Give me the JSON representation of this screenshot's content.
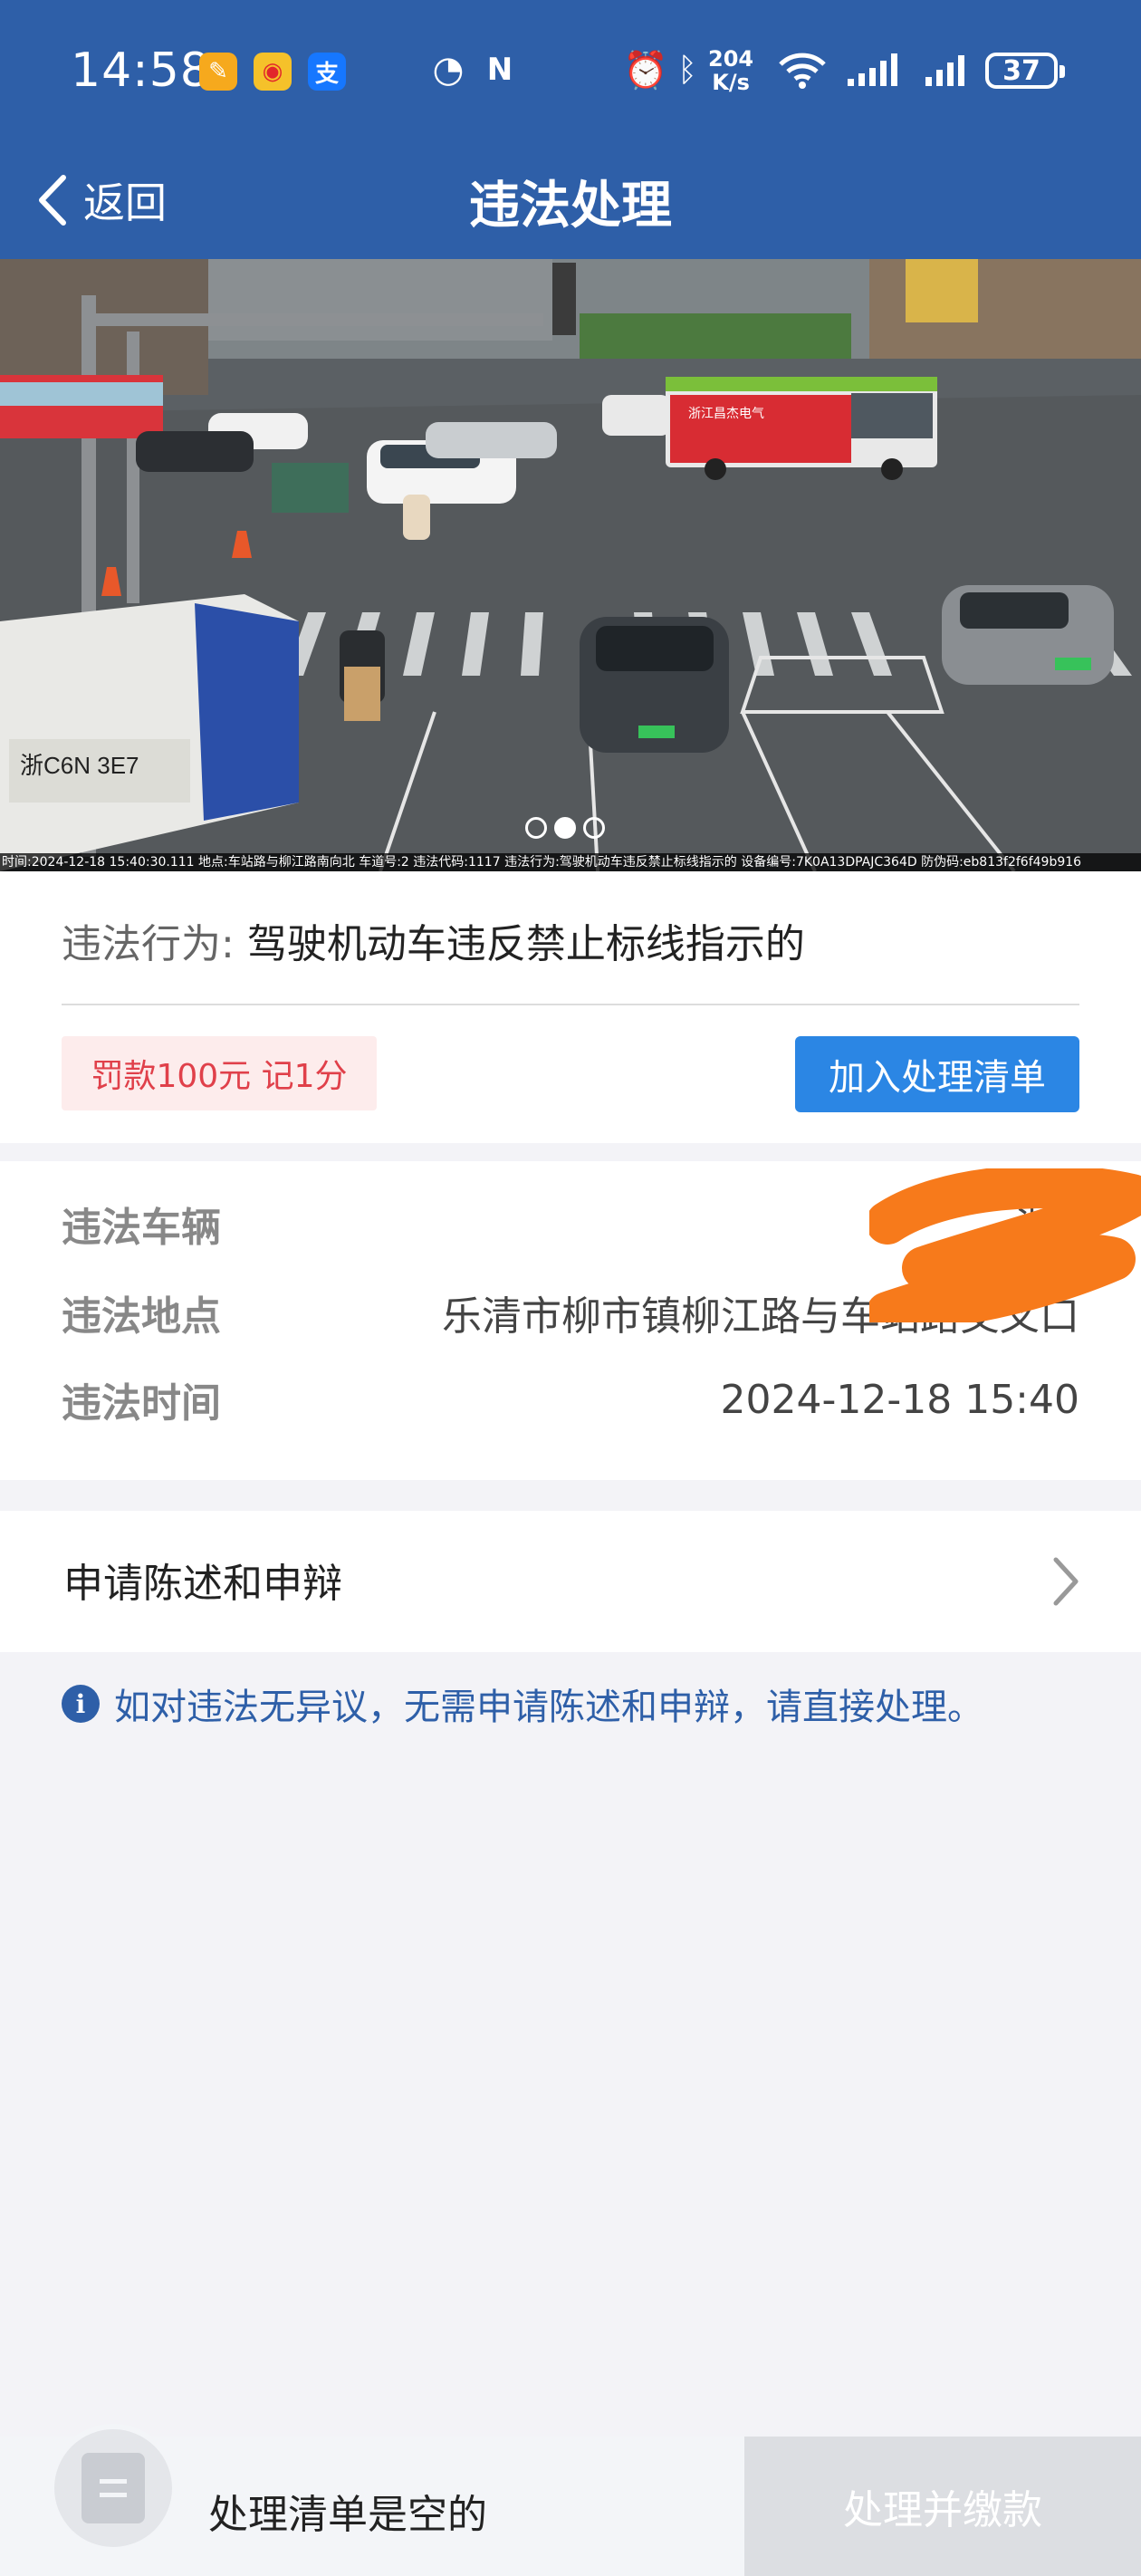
{
  "status_bar": {
    "time": "14:58",
    "network_speed_value": "204",
    "network_speed_unit": "K/s",
    "battery": "37",
    "icons": [
      "app-orange-icon",
      "weibo-icon",
      "alipay-icon",
      "speedometer-icon",
      "nfc-icon",
      "alarm-icon",
      "bluetooth-icon",
      "wifi-icon",
      "signal-icon",
      "signal-icon",
      "battery-icon"
    ]
  },
  "header": {
    "back_label": "返回",
    "title": "违法处理"
  },
  "photo": {
    "caption": "时间:2024-12-18 15:40:30.111 地点:车站路与柳江路南向北 车道号:2 违法代码:1117 违法行为:驾驶机动车违反禁止标线指示的 设备编号:7K0A13DPAJC364D 防伪码:eb813f2f6f49b916",
    "truck_plate": "浙C6N 3E7",
    "bus_text": "浙江昌杰电气",
    "pager_total": 3,
    "pager_active": 1
  },
  "violation": {
    "behavior_label": "违法行为:",
    "behavior_value": "驾驶机动车违反禁止标线指示的",
    "fine_text": "罚款100元 记1分",
    "add_button": "加入处理清单"
  },
  "details": {
    "vehicle_label": "违法车辆",
    "vehicle_value": "浙    J",
    "location_label": "违法地点",
    "location_value": "乐清市柳市镇柳江路与车站路交叉口",
    "time_label": "违法时间",
    "time_value": "2024-12-18 15:40"
  },
  "appeal": {
    "label": "申请陈述和申辩"
  },
  "notice": {
    "text": "如对违法无异议，无需申请陈述和申辩，请直接处理。"
  },
  "bottom_bar": {
    "empty_text": "处理清单是空的",
    "pay_button": "处理并缴款"
  },
  "colors": {
    "header_bg": "#2e5fa8",
    "accent_button": "#2b86e4",
    "fine_text": "#e0404a",
    "fine_bg": "#fdecec",
    "disabled_button": "#dcdee2",
    "scribble": "#f77a1b"
  }
}
